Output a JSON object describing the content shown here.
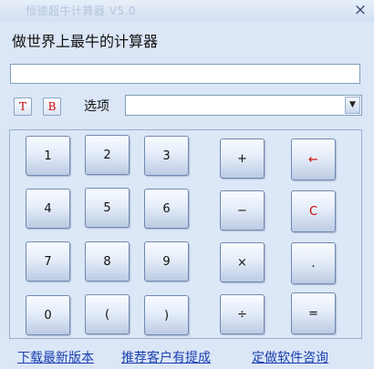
{
  "window": {
    "title": "恒德超牛计算器 V5.0",
    "close_label": "×"
  },
  "header": {
    "slogan": "做世界上最牛的计算器"
  },
  "display": {
    "value": ""
  },
  "toolbar": {
    "t_label": "T",
    "b_label": "B",
    "options_label": "选项",
    "options_value": "",
    "dropdown_label": "▼"
  },
  "keys": {
    "k1": "1",
    "k2": "2",
    "k3": "3",
    "k4": "4",
    "k5": "5",
    "k6": "6",
    "k7": "7",
    "k8": "8",
    "k9": "9",
    "k0": "0",
    "lparen": "(",
    "rparen": ")",
    "plus": "+",
    "minus": "−",
    "times": "×",
    "divide": "÷",
    "backspace": "←",
    "clear": "C",
    "dot": ".",
    "equals": "="
  },
  "footer": {
    "download": "下载最新版本",
    "recommend": "推荐客户有提成",
    "custom": "定做软件咨询"
  },
  "colors": {
    "accent_red": "#d00000",
    "link_blue": "#1a3fb0",
    "background": "#dbe6f6"
  }
}
